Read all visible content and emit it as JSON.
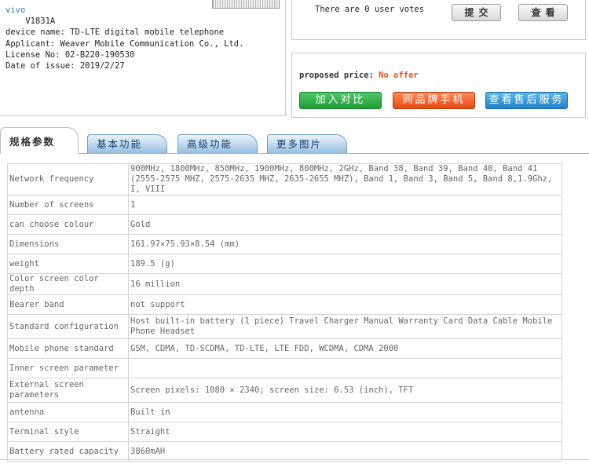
{
  "device": {
    "brand": "vivo",
    "model": "V1831A",
    "lines": [
      "device name: TD-LTE digital mobile telephone",
      "Applicant: Weaver Mobile Communication Co., Ltd.",
      "License No: 02-B220-190530",
      "Date of issue: 2019/2/27"
    ]
  },
  "votes": {
    "text": "There are 0 user votes",
    "submit_label": "提交",
    "view_label": "查看"
  },
  "price": {
    "label": "proposed price:",
    "value": "No offer"
  },
  "actions": {
    "compare": "加入对比",
    "same_brand": "同品牌手机",
    "after_sales": "查看售后服务"
  },
  "tabs": [
    {
      "label": "规格参数",
      "active": true
    },
    {
      "label": "基本功能",
      "active": false
    },
    {
      "label": "高级功能",
      "active": false
    },
    {
      "label": "更多图片",
      "active": false
    }
  ],
  "specs": [
    {
      "key": "Network frequency",
      "value": "900MHz, 1800MHz, 850MHz, 1900MHz, 800MHz, 2GHz, Band 38, Band 39, Band 40, Band 41 (2555-2575 MHZ, 2575-2635 MHZ, 2635-2655 MHZ), Band 1, Band 3, Band 5, Band 8,1.9Ghz, I, VIII"
    },
    {
      "key": "Number of screens",
      "value": "1"
    },
    {
      "key": "can choose colour",
      "value": "Gold"
    },
    {
      "key": "Dimensions",
      "value": "161.97×75.93×8.54 (mm)"
    },
    {
      "key": "weight",
      "value": "189.5 (g)"
    },
    {
      "key": "Color screen color depth",
      "value": "16 million"
    },
    {
      "key": "Bearer band",
      "value": "not support"
    },
    {
      "key": "Standard configuration",
      "value": "Host built-in battery (1 piece) Travel Charger Manual Warranty Card Data Cable Mobile Phone Headset"
    },
    {
      "key": "Mobile phone standard",
      "value": "GSM, CDMA, TD-SCDMA, TD-LTE, LTE FDD, WCDMA, CDMA 2000"
    },
    {
      "key": "Inner screen parameter",
      "value": ""
    },
    {
      "key": "External screen parameters",
      "value": "Screen pixels: 1080 × 2340; screen size: 6.53 (inch), TFT"
    },
    {
      "key": "antenna",
      "value": "Built in"
    },
    {
      "key": "Terminal style",
      "value": "Straight"
    },
    {
      "key": "Battery rated capacity",
      "value": "3860mAH"
    }
  ]
}
